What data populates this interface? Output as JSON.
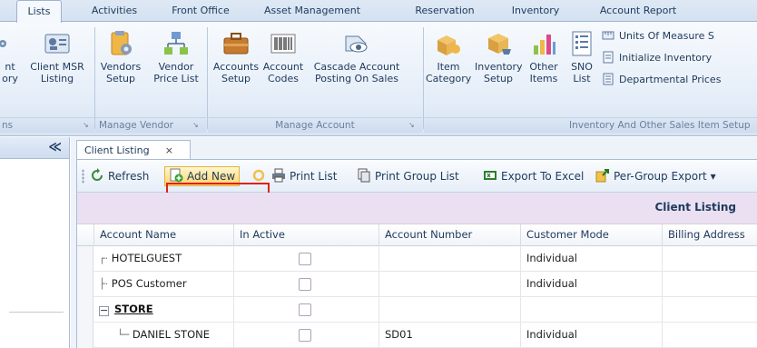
{
  "ribbon_tabs": [
    {
      "label": "Lists",
      "active": true
    },
    {
      "label": "Activities"
    },
    {
      "label": "Front Office"
    },
    {
      "label": "Asset Management"
    },
    {
      "label": "Reservation"
    },
    {
      "label": "Inventory"
    },
    {
      "label": "Account Report"
    }
  ],
  "ribbon": {
    "clipped_left": {
      "line1": "nt",
      "line2": "ory",
      "group": "ns"
    },
    "client_msr": {
      "line1": "Client MSR",
      "line2": "Listing"
    },
    "vendors_setup": {
      "line1": "Vendors",
      "line2": "Setup"
    },
    "vendor_price": {
      "line1": "Vendor",
      "line2": "Price List"
    },
    "manage_vendor_label": "Manage Vendor",
    "accounts_setup": {
      "line1": "Accounts",
      "line2": "Setup"
    },
    "account_codes": {
      "line1": "Account",
      "line2": "Codes"
    },
    "cascade_account": {
      "line1": "Cascade Account",
      "line2": "Posting On Sales"
    },
    "manage_account_label": "Manage Account",
    "item_category": {
      "line1": "Item",
      "line2": "Category"
    },
    "inventory_setup": {
      "line1": "Inventory",
      "line2": "Setup"
    },
    "other_items": {
      "line1": "Other",
      "line2": "Items"
    },
    "sno_list": {
      "line1": "SNO",
      "line2": "List"
    },
    "units_of_measure": "Units Of Measure S",
    "initialize_inventory": "Initialize Inventory",
    "departmental_prices": "Departmental Prices",
    "inventory_group_label": "Inventory And Other Sales Item Setup"
  },
  "leftpanel": {
    "collapse_glyph": "≪"
  },
  "document_tab": {
    "label": "Client Listing",
    "close": "×"
  },
  "toolbar": {
    "refresh": "Refresh",
    "add_new": "Add New",
    "print_list": "Print List",
    "print_group_list": "Print Group List",
    "export_excel": "Export To Excel",
    "per_group_export": "Per-Group Export ▾"
  },
  "grid": {
    "title": "Client Listing",
    "columns": [
      "Account Name",
      "In Active",
      "Account Number",
      "Customer Mode",
      "Billing Address"
    ],
    "rows": [
      {
        "name": "HOTELGUEST",
        "tree": "┌·",
        "account_number": "",
        "mode": "Individual"
      },
      {
        "name": "POS Customer",
        "tree": "├·",
        "account_number": "",
        "mode": "Individual"
      },
      {
        "name": "STORE",
        "expander": "−",
        "account_number": "",
        "mode": ""
      },
      {
        "name": "DANIEL STONE",
        "tree": "└─",
        "account_number": "SD01",
        "mode": "Individual"
      }
    ]
  },
  "colors": {
    "accent": "#1e395b",
    "highlight_box": "#e02020",
    "grid_title_band": "#eae0f2"
  }
}
